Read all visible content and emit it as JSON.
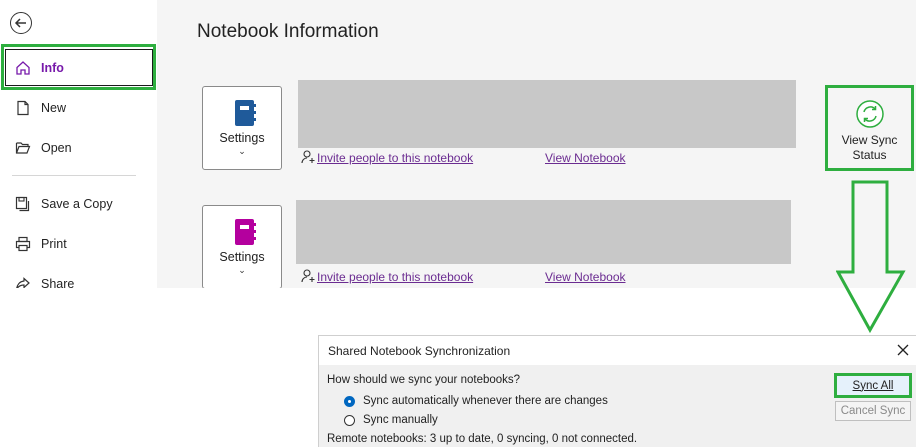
{
  "sidebar": {
    "items": [
      {
        "label": "Info",
        "icon": "home-icon"
      },
      {
        "label": "New",
        "icon": "new-page-icon"
      },
      {
        "label": "Open",
        "icon": "folder-open-icon"
      },
      {
        "label": "Save a Copy",
        "icon": "save-copy-icon"
      },
      {
        "label": "Print",
        "icon": "print-icon"
      },
      {
        "label": "Share",
        "icon": "share-icon"
      }
    ]
  },
  "main": {
    "title": "Notebook Information",
    "notebooks": [
      {
        "settings_label": "Settings",
        "invite_link": "Invite people to this notebook",
        "view_link": "View Notebook",
        "color": "#1f5a9a"
      },
      {
        "settings_label": "Settings",
        "invite_link": "Invite people to this notebook",
        "view_link": "View Notebook",
        "color": "#b4009e"
      }
    ],
    "sync_button": {
      "line1": "View Sync",
      "line2": "Status"
    }
  },
  "dialog": {
    "title": "Shared Notebook Synchronization",
    "question": "How should we sync your notebooks?",
    "options": [
      {
        "label": "Sync automatically whenever there are changes",
        "selected": true
      },
      {
        "label": "Sync manually",
        "selected": false
      }
    ],
    "status": "Remote notebooks: 3 up to date, 0 syncing, 0 not connected.",
    "sync_all_label": "Sync All",
    "cancel_label": "Cancel Sync"
  },
  "colors": {
    "highlight": "#2eae3f",
    "accent": "#7719aa",
    "link": "#6b2c91"
  }
}
